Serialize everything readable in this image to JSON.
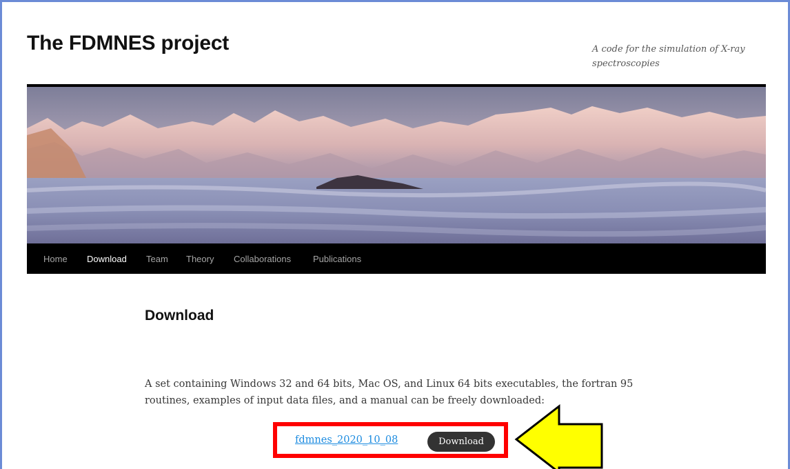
{
  "header": {
    "site_title": "The FDMNES project",
    "site_description": "A code for the simulation of X-ray spectroscopies"
  },
  "nav": {
    "items": [
      {
        "label": "Home",
        "active": false
      },
      {
        "label": "Download",
        "active": true
      },
      {
        "label": "Team",
        "active": false
      },
      {
        "label": "Theory",
        "active": false
      },
      {
        "label": "Collaborations",
        "active": false
      },
      {
        "label": "Publications",
        "active": false
      }
    ]
  },
  "main": {
    "page_title": "Download",
    "intro_text": "A set containing Windows 32 and 64 bits, Mac OS, and Linux 64 bits executables, the fortran 95 routines, examples of input data files, and a manual can be freely downloaded:",
    "download_link_label": "fdmnes_2020_10_08",
    "download_button_label": "Download"
  },
  "annotations": {
    "highlight_box_color": "#ff0000",
    "arrow_color": "#ffff00",
    "arrow_direction": "left"
  },
  "colors": {
    "frame_border": "#6b8bd6",
    "nav_background": "#000000",
    "link": "#1b8be0",
    "button_background": "#333333"
  }
}
